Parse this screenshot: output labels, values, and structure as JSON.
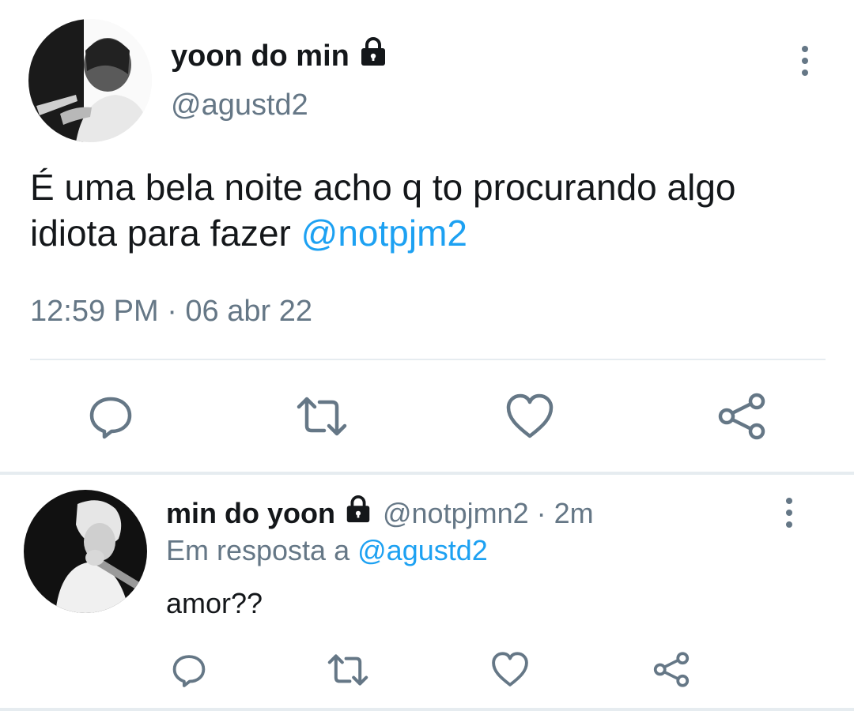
{
  "main_tweet": {
    "display_name": "yoon do min",
    "handle": "@agustd2",
    "protected_icon": "lock-icon",
    "text": "É uma bela noite acho q to procurando algo idiota para fazer",
    "mention": "@notpjm2",
    "timestamp": "12:59 PM · 06 abr 22",
    "actions": [
      {
        "name": "reply",
        "icon": "reply-icon"
      },
      {
        "name": "retweet",
        "icon": "retweet-icon"
      },
      {
        "name": "like",
        "icon": "heart-icon"
      },
      {
        "name": "share",
        "icon": "share-icon"
      }
    ]
  },
  "reply_tweet": {
    "display_name": "min do yoon",
    "protected_icon": "lock-icon",
    "handle_time": "@notpjmn2 · 2m",
    "reply_prefix": "Em resposta a",
    "reply_to": "@agustd2",
    "text": "amor??",
    "actions": [
      {
        "name": "reply",
        "icon": "reply-icon"
      },
      {
        "name": "retweet",
        "icon": "retweet-icon"
      },
      {
        "name": "like",
        "icon": "heart-icon"
      },
      {
        "name": "share",
        "icon": "share-icon"
      }
    ]
  },
  "colors": {
    "text_primary": "#14171a",
    "text_secondary": "#657786",
    "link": "#1da1f2",
    "divider": "#e6ecf0"
  }
}
